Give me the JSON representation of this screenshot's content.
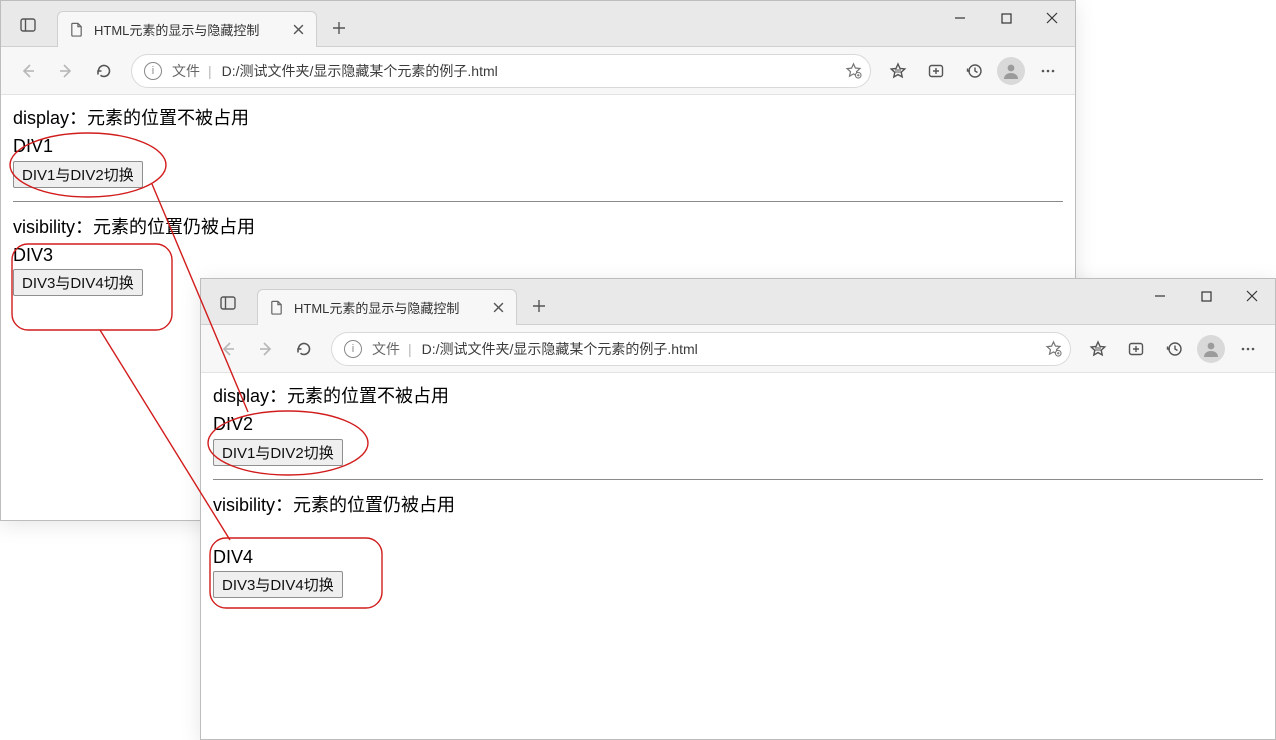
{
  "tab_title": "HTML元素的显示与隐藏控制",
  "address": {
    "scheme": "文件",
    "sep": "|",
    "url": "D:/测试文件夹/显示隐藏某个元素的例子.html"
  },
  "content": {
    "section1_label": "display：元素的位置不被占用",
    "section2_label": "visibility：元素的位置仍被占用",
    "btn12": "DIV1与DIV2切换",
    "btn34": "DIV3与DIV4切换",
    "state_a": {
      "sec1_text": "DIV1",
      "sec2_text": "DIV3",
      "sec2_has_gap": false
    },
    "state_b": {
      "sec1_text": "DIV2",
      "sec2_text": "DIV4",
      "sec2_has_gap": true
    }
  }
}
